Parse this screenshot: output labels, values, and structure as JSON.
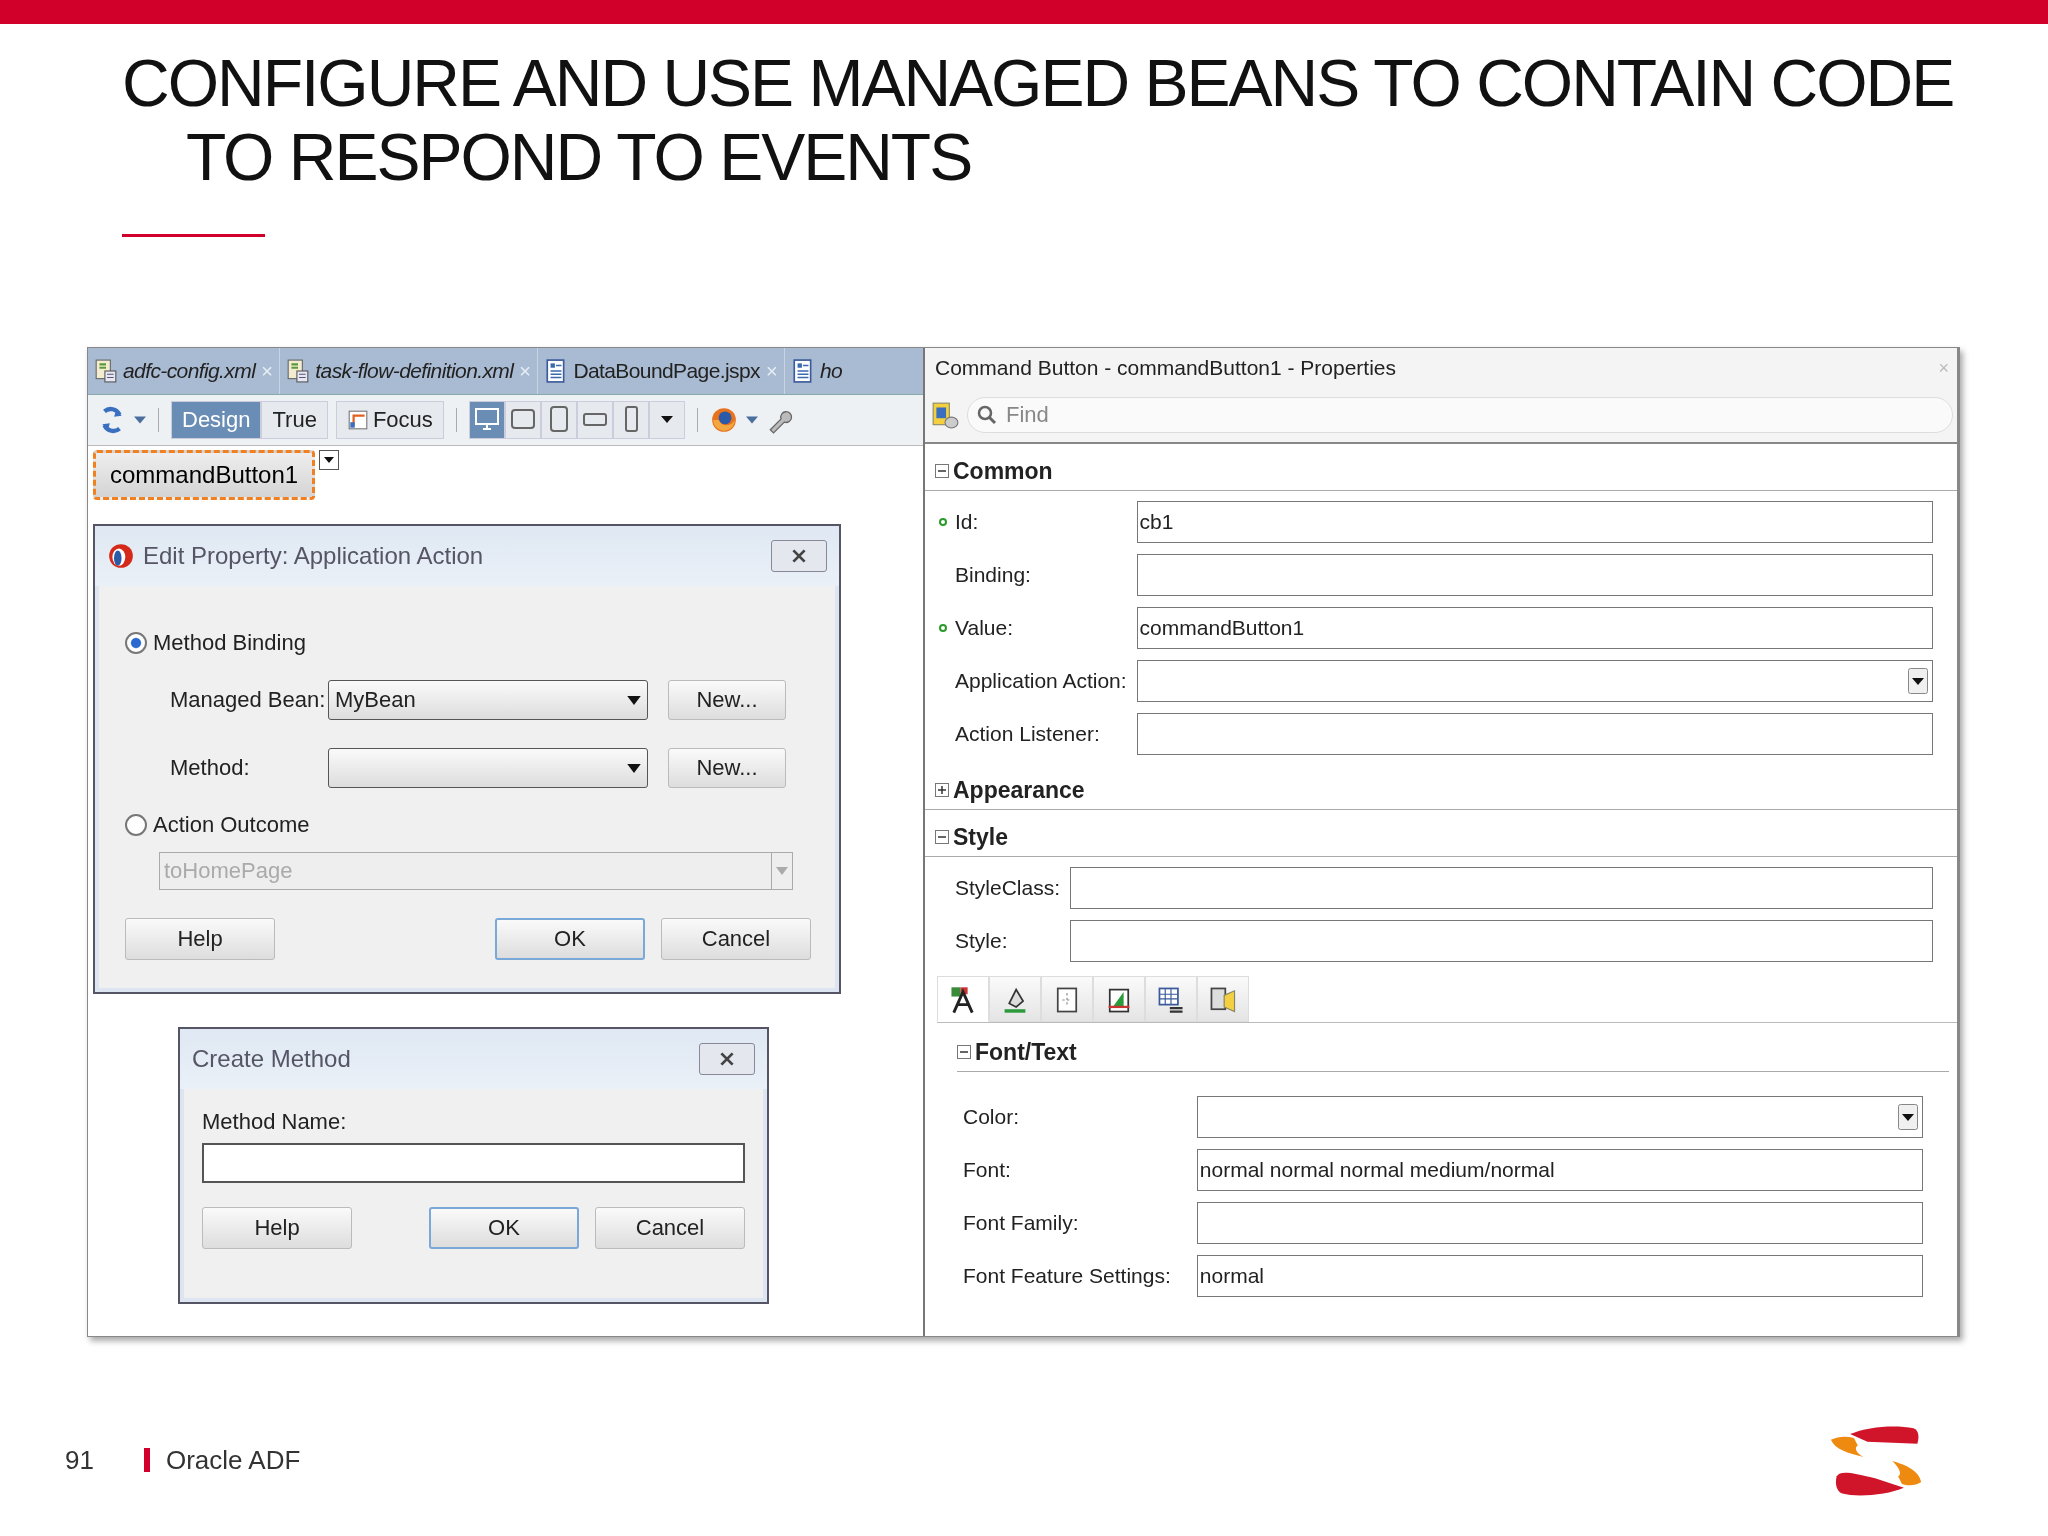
{
  "slide": {
    "title": "CONFIGURE AND USE MANAGED BEANS TO CONTAIN CODE TO RESPOND TO EVENTS",
    "page_number": "91",
    "footer": "Oracle ADF"
  },
  "editor": {
    "tabs": [
      {
        "label": "adfc-config.xml",
        "kind": "xml",
        "italic": true,
        "close": "×"
      },
      {
        "label": "task-flow-definition.xml",
        "kind": "xml",
        "italic": true,
        "close": "×"
      },
      {
        "label": "DataBoundPage.jspx",
        "kind": "page",
        "italic": false,
        "close": "×"
      },
      {
        "label": "ho",
        "kind": "page",
        "italic": true
      }
    ],
    "modes": [
      {
        "label": "Design",
        "selected": true
      },
      {
        "label": "True",
        "selected": false
      },
      {
        "label": "Focus",
        "selected": false
      }
    ],
    "devices": [
      {
        "kind": "desktop",
        "selected": true
      },
      {
        "kind": "tablet-landscape",
        "selected": false
      },
      {
        "kind": "tablet",
        "selected": false
      },
      {
        "kind": "phone-landscape",
        "selected": false
      },
      {
        "kind": "phone",
        "selected": false
      }
    ],
    "component": "commandButton1"
  },
  "edit_dialog": {
    "title": "Edit Property: Application Action",
    "options": [
      {
        "label": "Method Binding",
        "selected": true
      },
      {
        "label": "Action Outcome",
        "selected": false
      }
    ],
    "fields": [
      {
        "label": "Managed Bean:",
        "value": "MyBean",
        "button": "New..."
      },
      {
        "label": "Method:",
        "button": "New..."
      }
    ],
    "outcome": {
      "value": "toHomePage",
      "disabled": true
    },
    "buttons": [
      {
        "label": "Help",
        "default": false
      },
      {
        "label": "OK",
        "default": true
      },
      {
        "label": "Cancel",
        "default": false
      }
    ]
  },
  "create_dialog": {
    "title": "Create Method",
    "field_label": "Method Name:",
    "buttons": [
      {
        "label": "Help",
        "default": false
      },
      {
        "label": "OK",
        "default": true
      },
      {
        "label": "Cancel",
        "default": false
      }
    ]
  },
  "properties": {
    "title": "Command Button - commandButton1 - Properties",
    "close": "×",
    "search": {
      "placeholder": "Find"
    },
    "sections": [
      {
        "name": "Common",
        "expanded": true,
        "rows": [
          {
            "label": "Id:",
            "value": "cb1",
            "kind": "text",
            "set": true
          },
          {
            "label": "Binding:",
            "value": "",
            "kind": "text",
            "set": false
          },
          {
            "label": "Value:",
            "value": "commandButton1",
            "kind": "text",
            "set": true
          },
          {
            "label": "Application Action:",
            "value": "",
            "kind": "dropdown",
            "set": false
          },
          {
            "label": "Action Listener:",
            "value": "",
            "kind": "text",
            "set": false
          }
        ]
      },
      {
        "name": "Appearance",
        "expanded": false
      },
      {
        "name": "Style",
        "expanded": true,
        "rows": [
          {
            "label": "StyleClass:",
            "value": "",
            "kind": "text",
            "set": false
          },
          {
            "label": "Style:",
            "value": "",
            "kind": "text",
            "set": false
          }
        ]
      }
    ],
    "style_tabs": [
      {
        "kind": "text",
        "selected": true
      },
      {
        "kind": "fill",
        "selected": false
      },
      {
        "kind": "box",
        "selected": false
      },
      {
        "kind": "position",
        "selected": false
      },
      {
        "kind": "table",
        "selected": false
      },
      {
        "kind": "media",
        "selected": false
      }
    ],
    "subsection": {
      "name": "Font/Text",
      "expanded": true,
      "rows": [
        {
          "label": "Color:",
          "value": "",
          "kind": "dropdown"
        },
        {
          "label": "Font:",
          "value": "normal normal normal medium/normal",
          "kind": "text"
        },
        {
          "label": "Font Family:",
          "value": "",
          "kind": "text"
        },
        {
          "label": "Font Feature Settings:",
          "value": "normal",
          "kind": "text"
        }
      ]
    }
  }
}
